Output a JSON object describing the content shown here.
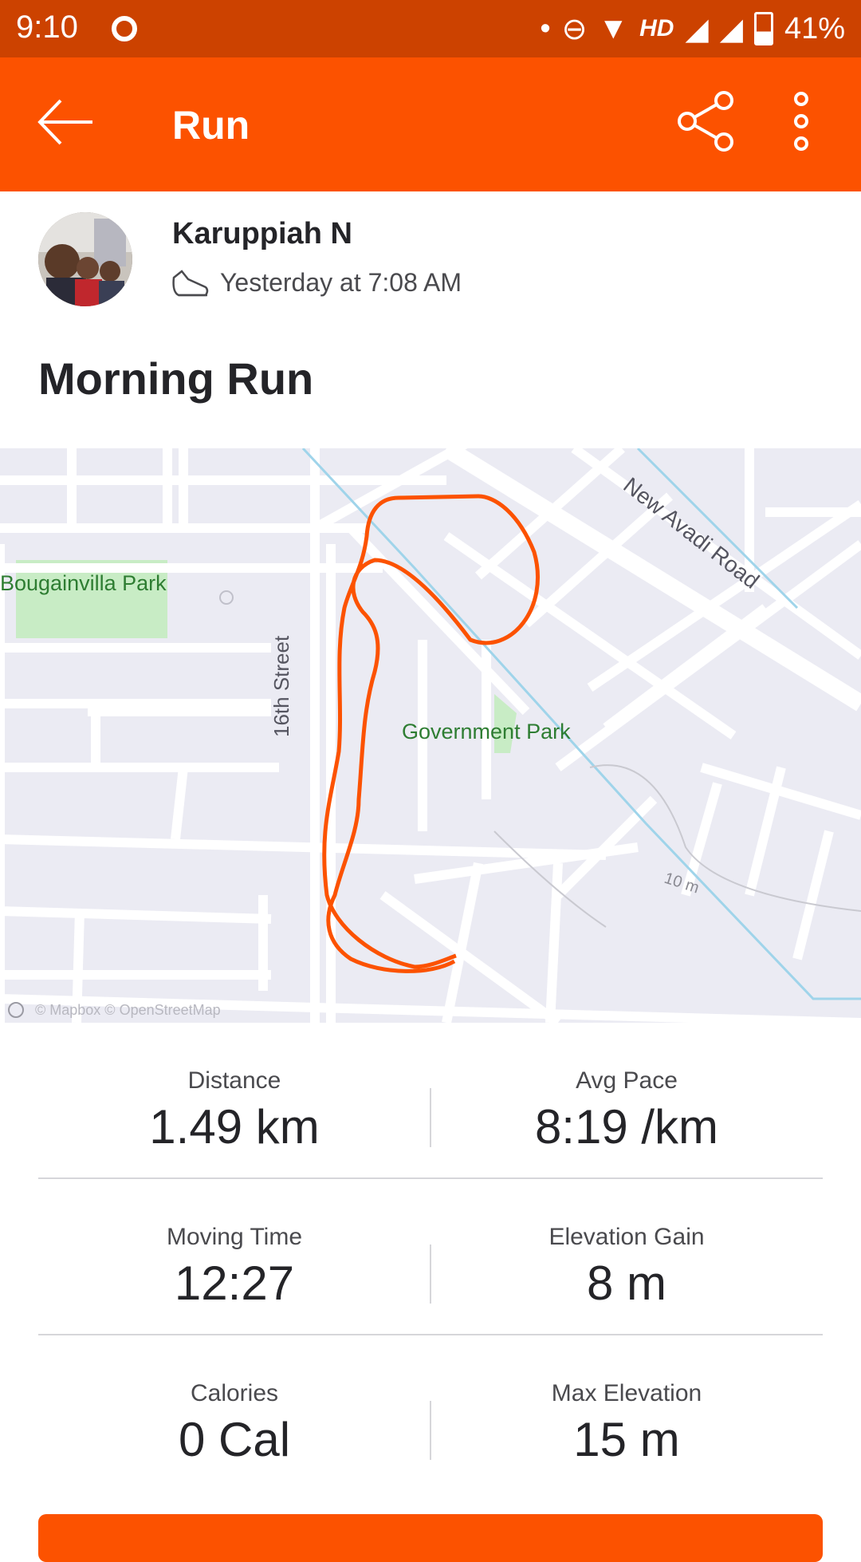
{
  "status_bar": {
    "time": "9:10",
    "network": "HD",
    "battery": "41%"
  },
  "app_bar": {
    "title": "Run",
    "back_icon": "arrow-left-icon",
    "share_icon": "share-icon",
    "more_icon": "more-vertical-icon"
  },
  "athlete": {
    "name": "Karuppiah N",
    "activity_icon": "shoe-icon",
    "time": "Yesterday at 7:08 AM"
  },
  "activity": {
    "title": "Morning Run"
  },
  "map": {
    "labels": {
      "park1": "Bougainvilla Park",
      "street": "16th Street",
      "park2": "Government Park",
      "road": "New Avadi Road",
      "scale": "10 m",
      "attribution": "© Mapbox © OpenStreetMap"
    },
    "route_color": "#fc5200"
  },
  "stats": [
    [
      {
        "label": "Distance",
        "value": "1.49 km"
      },
      {
        "label": "Avg Pace",
        "value": "8:19 /km"
      }
    ],
    [
      {
        "label": "Moving Time",
        "value": "12:27"
      },
      {
        "label": "Elevation Gain",
        "value": "8 m"
      }
    ],
    [
      {
        "label": "Calories",
        "value": "0 Cal"
      },
      {
        "label": "Max Elevation",
        "value": "15 m"
      }
    ]
  ],
  "colors": {
    "brand": "#fc5200",
    "status_bar": "#cc4200"
  }
}
